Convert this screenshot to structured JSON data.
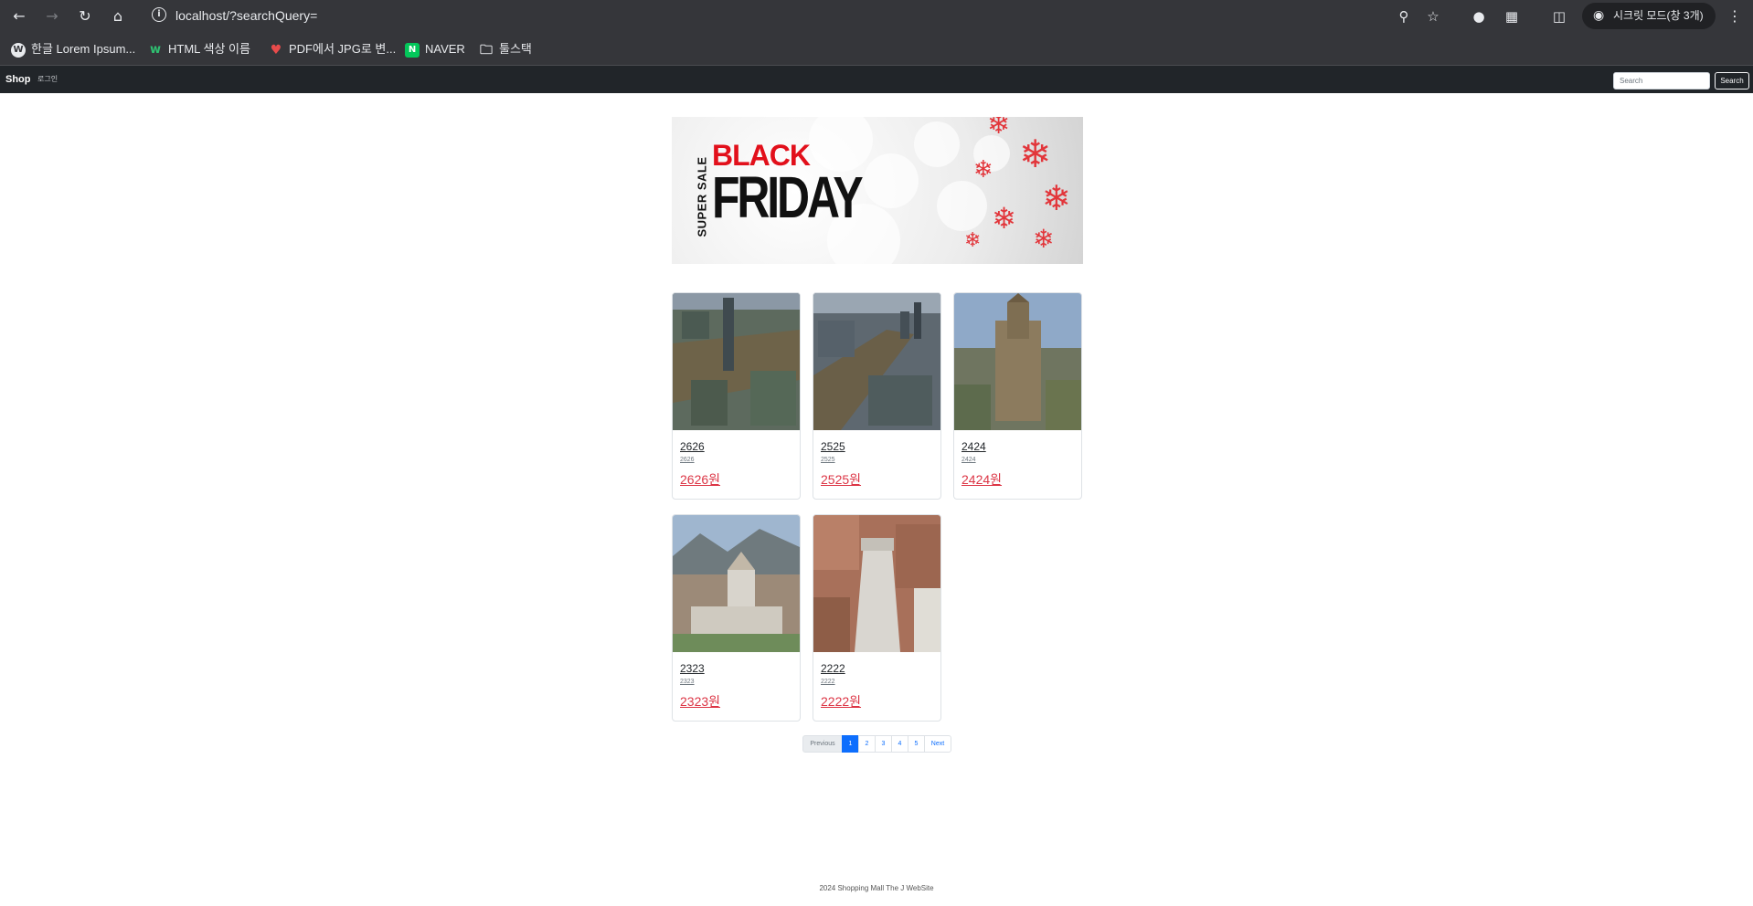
{
  "browser": {
    "url": "localhost/?searchQuery=",
    "incognito_label": "시크릿 모드(창 3개)",
    "bookmarks": [
      {
        "label": "한글 Lorem Ipsum...",
        "icon": "wordpress-icon"
      },
      {
        "label": "HTML 색상 이름",
        "icon": "w-logo-icon"
      },
      {
        "label": "PDF에서 JPG로 변...",
        "icon": "heart-icon"
      },
      {
        "label": "NAVER",
        "icon": "naver-icon"
      },
      {
        "label": "툴스택",
        "icon": "folder-icon"
      }
    ]
  },
  "navbar": {
    "brand": "Shop",
    "login": "로그인",
    "search_placeholder": "Search",
    "search_button": "Search"
  },
  "banner": {
    "super_sale": "SUPER SALE",
    "black": "BLACK",
    "friday": "FRIDAY"
  },
  "products": [
    {
      "title": "2626",
      "subtitle": "2626",
      "price": "2626원"
    },
    {
      "title": "2525",
      "subtitle": "2525",
      "price": "2525원"
    },
    {
      "title": "2424",
      "subtitle": "2424",
      "price": "2424원"
    },
    {
      "title": "2323",
      "subtitle": "2323",
      "price": "2323원"
    },
    {
      "title": "2222",
      "subtitle": "2222",
      "price": "2222원"
    }
  ],
  "pagination": {
    "previous": "Previous",
    "pages": [
      "1",
      "2",
      "3",
      "4",
      "5"
    ],
    "active_page": "1",
    "next": "Next"
  },
  "footer": {
    "text": "2024 Shopping Mall The J WebSite"
  },
  "colors": {
    "navbar_bg": "#212529",
    "price": "#dc3545",
    "active_page": "#0d6efd"
  }
}
